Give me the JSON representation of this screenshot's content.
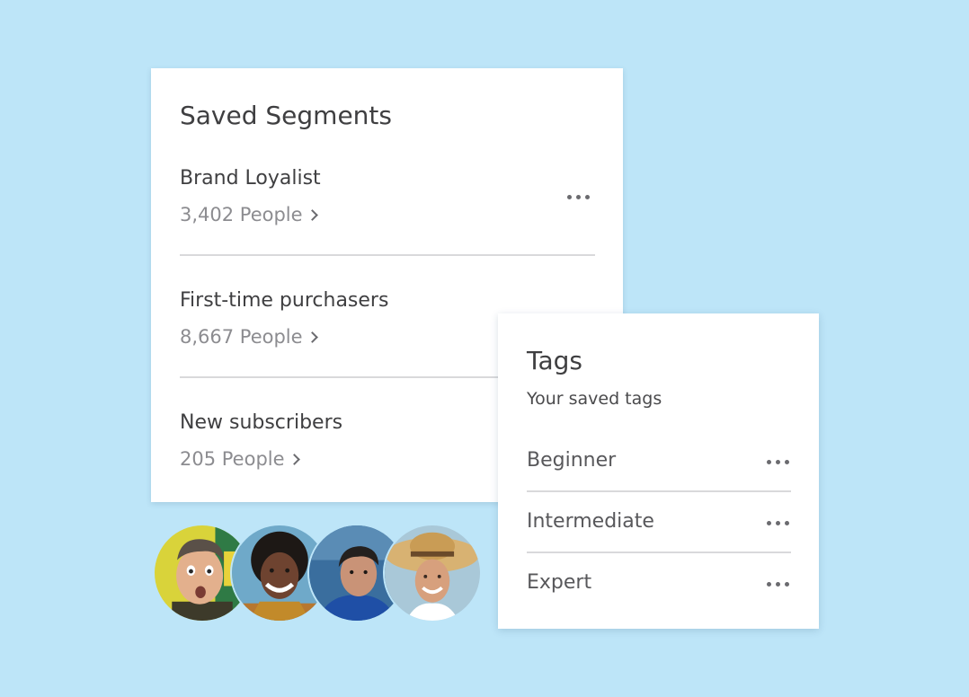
{
  "segments_card": {
    "title": "Saved Segments",
    "items": [
      {
        "name": "Brand Loyalist",
        "count": "3,402 People",
        "has_menu": true
      },
      {
        "name": "First-time purchasers",
        "count": "8,667 People"
      },
      {
        "name": "New subscribers",
        "count": "205 People"
      }
    ]
  },
  "tags_card": {
    "title": "Tags",
    "subtitle": "Your saved tags",
    "items": [
      {
        "name": "Beginner"
      },
      {
        "name": "Intermediate"
      },
      {
        "name": "Expert"
      }
    ]
  },
  "avatars": [
    {
      "icon": "avatar-man-surprised",
      "bg": "#d8d234"
    },
    {
      "icon": "avatar-woman-curly-hair",
      "bg": "#6aa7c9"
    },
    {
      "icon": "avatar-man-blue-jacket",
      "bg": "#2f6fb4"
    },
    {
      "icon": "avatar-woman-straw-hat",
      "bg": "#a8c7d6"
    }
  ],
  "colors": {
    "background": "#bde5f8",
    "card": "#ffffff",
    "text_primary": "#3f3f41",
    "text_secondary": "#8c8c90",
    "divider": "#d9d9db"
  }
}
